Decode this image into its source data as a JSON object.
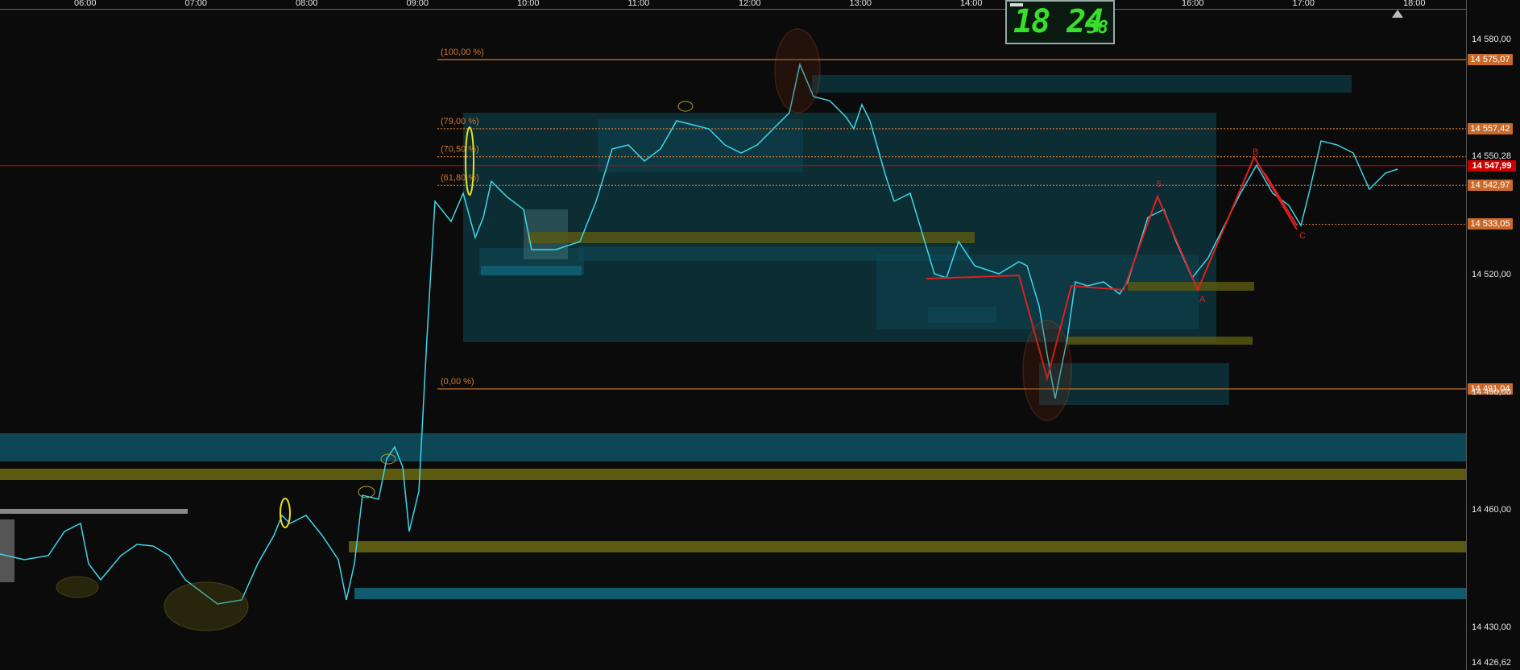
{
  "time_axis": {
    "labels": [
      "06:00",
      "07:00",
      "08:00",
      "09:00",
      "10:00",
      "11:00",
      "12:00",
      "13:00",
      "14:00",
      "16:00",
      "17:00",
      "18:00"
    ],
    "hours": [
      6,
      7,
      8,
      9,
      10,
      11,
      12,
      13,
      14,
      16,
      17,
      18
    ]
  },
  "price_axis": {
    "labels": [
      "14 580,00",
      "14 520,00",
      "14 460,00",
      "14 430,00"
    ],
    "values": [
      14580,
      14520,
      14460,
      14430
    ],
    "partial_labels": [
      "14 550,28",
      "14 490,00",
      "14 426,62"
    ]
  },
  "price_tags": [
    {
      "label": "14 575,07",
      "value": 14575.07,
      "color": "#c96a2c"
    },
    {
      "label": "14 557,42",
      "value": 14557.42,
      "color": "#c96a2c"
    },
    {
      "label": "14 547,99",
      "value": 14547.99,
      "color": "#cc0000"
    },
    {
      "label": "14 542,97",
      "value": 14542.97,
      "color": "#c96a2c"
    },
    {
      "label": "14 533,05",
      "value": 14533.05,
      "color": "#c96a2c"
    },
    {
      "label": "14 491,04",
      "value": 14491.04,
      "color": "#c96a2c"
    }
  ],
  "fib_levels": [
    {
      "label": "(100,00 %)",
      "value": 14575.07
    },
    {
      "label": "(79,00 %)",
      "value": 14557.42
    },
    {
      "label": "(70,50 %)",
      "value": 14550.28
    },
    {
      "label": "(61,80 %)",
      "value": 14542.97
    },
    {
      "label": "(0,00 %)",
      "value": 14491.04
    }
  ],
  "current_price": {
    "value": 14547.99,
    "color": "#cc0000"
  },
  "clock": {
    "hours_minutes": "18 24",
    "seconds": "38"
  },
  "wave_labels": [
    "5",
    "B",
    "A",
    "C"
  ],
  "colors": {
    "background": "#0b0b0b",
    "price_line": "#3fd6e8",
    "fib_line": "#d0772f",
    "zone_cyan": "#0e4a58",
    "zone_olive": "#5b5a10",
    "wave": "#e02020",
    "highlight_yellow": "#e8e020"
  }
}
